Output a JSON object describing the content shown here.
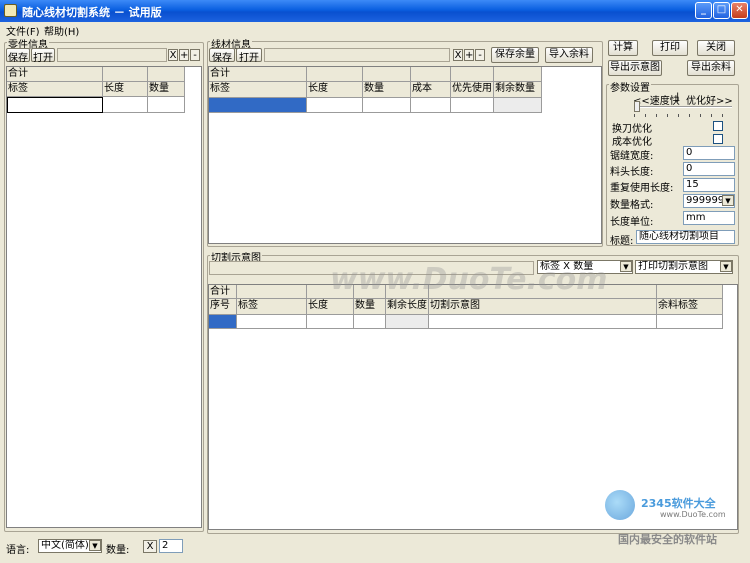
{
  "window": {
    "title": "随心线材切割系统 － 试用版"
  },
  "menu": [
    "文件(F)",
    "帮助(H)"
  ],
  "parts": {
    "label": "零件信息",
    "save": "保存",
    "open": "打开",
    "x": "X",
    "plus": "+",
    "minus": "-",
    "total": "合计",
    "columns": [
      "标签",
      "长度",
      "数量"
    ]
  },
  "stock": {
    "label": "线材信息",
    "save": "保存",
    "open": "打开",
    "x": "X",
    "plus": "+",
    "minus": "-",
    "save_remain": "保存余量",
    "import_remain": "导入余料",
    "total": "合计",
    "columns": [
      "标签",
      "长度",
      "数量",
      "成本",
      "优先使用",
      "剩余数量"
    ]
  },
  "actions": {
    "calc": "计算",
    "print": "打印",
    "close": "关闭",
    "export_diagram": "导出示意图",
    "export_remain": "导出余料"
  },
  "params": {
    "label": "参数设置",
    "slider_left": "<<速度快",
    "slider_sep": "|",
    "slider_right": "优化好>>",
    "swap_opt": "换刀优化",
    "cost_opt": "成本优化",
    "kerf_label": "锯缝宽度:",
    "kerf_value": "0",
    "head_label": "料头长度:",
    "head_value": "0",
    "reuse_label": "重复使用长度:",
    "reuse_value": "15",
    "qty_fmt_label": "数量格式:",
    "qty_fmt_value": "999999",
    "unit_label": "长度单位:",
    "unit_value": "mm",
    "title_label": "标题:",
    "title_value": "随心线材切割项目"
  },
  "cut": {
    "label": "切割示意图",
    "label_combo": "标签 X 数量",
    "print_combo": "打印切割示意图",
    "total": "合计",
    "columns": [
      "序号",
      "标签",
      "长度",
      "数量",
      "剩余长度",
      "切割示意图",
      "余料标签"
    ]
  },
  "bottom": {
    "lang_label": "语言:",
    "lang_value": "中文(简体)",
    "qty_label": "数量:",
    "x": "X",
    "qty_value": "2"
  },
  "watermark": {
    "site": "www.DuoTe.com",
    "brand": "2345软件大全",
    "brand_url": "www.DuoTe.com",
    "slogan": "国内最安全的软件站"
  }
}
